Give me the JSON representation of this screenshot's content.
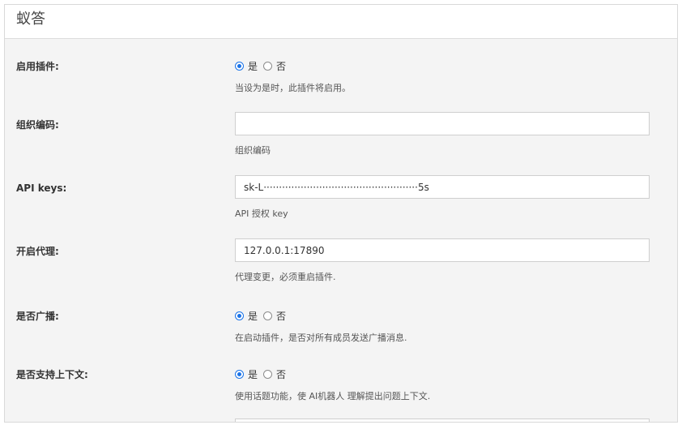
{
  "header": {
    "title": "蚁答"
  },
  "form": {
    "enable_plugin": {
      "label": "启用插件:",
      "options": [
        "是",
        "否"
      ],
      "selected": "是",
      "help": "当设为是时，此插件将启用。"
    },
    "org_code": {
      "label": "组织编码:",
      "value": "",
      "help": "组织编码"
    },
    "api_keys": {
      "label": "API keys:",
      "value": "sk-L··················································5s",
      "help": "API 授权 key"
    },
    "proxy": {
      "label": "开启代理:",
      "value": "127.0.0.1:17890",
      "help": "代理变更，必须重启插件."
    },
    "broadcast": {
      "label": "是否广播:",
      "options": [
        "是",
        "否"
      ],
      "selected": "是",
      "help": "在启动插件，是否对所有成员发送广播消息."
    },
    "context": {
      "label": "是否支持上下文:",
      "options": [
        "是",
        "否"
      ],
      "selected": "是",
      "help": "使用话题功能，使 AI机器人 理解提出问题上下文."
    }
  },
  "colors": {
    "accent": "#1a73e8",
    "panel_bg": "#f4f4f4",
    "border": "#d9d9d9"
  }
}
